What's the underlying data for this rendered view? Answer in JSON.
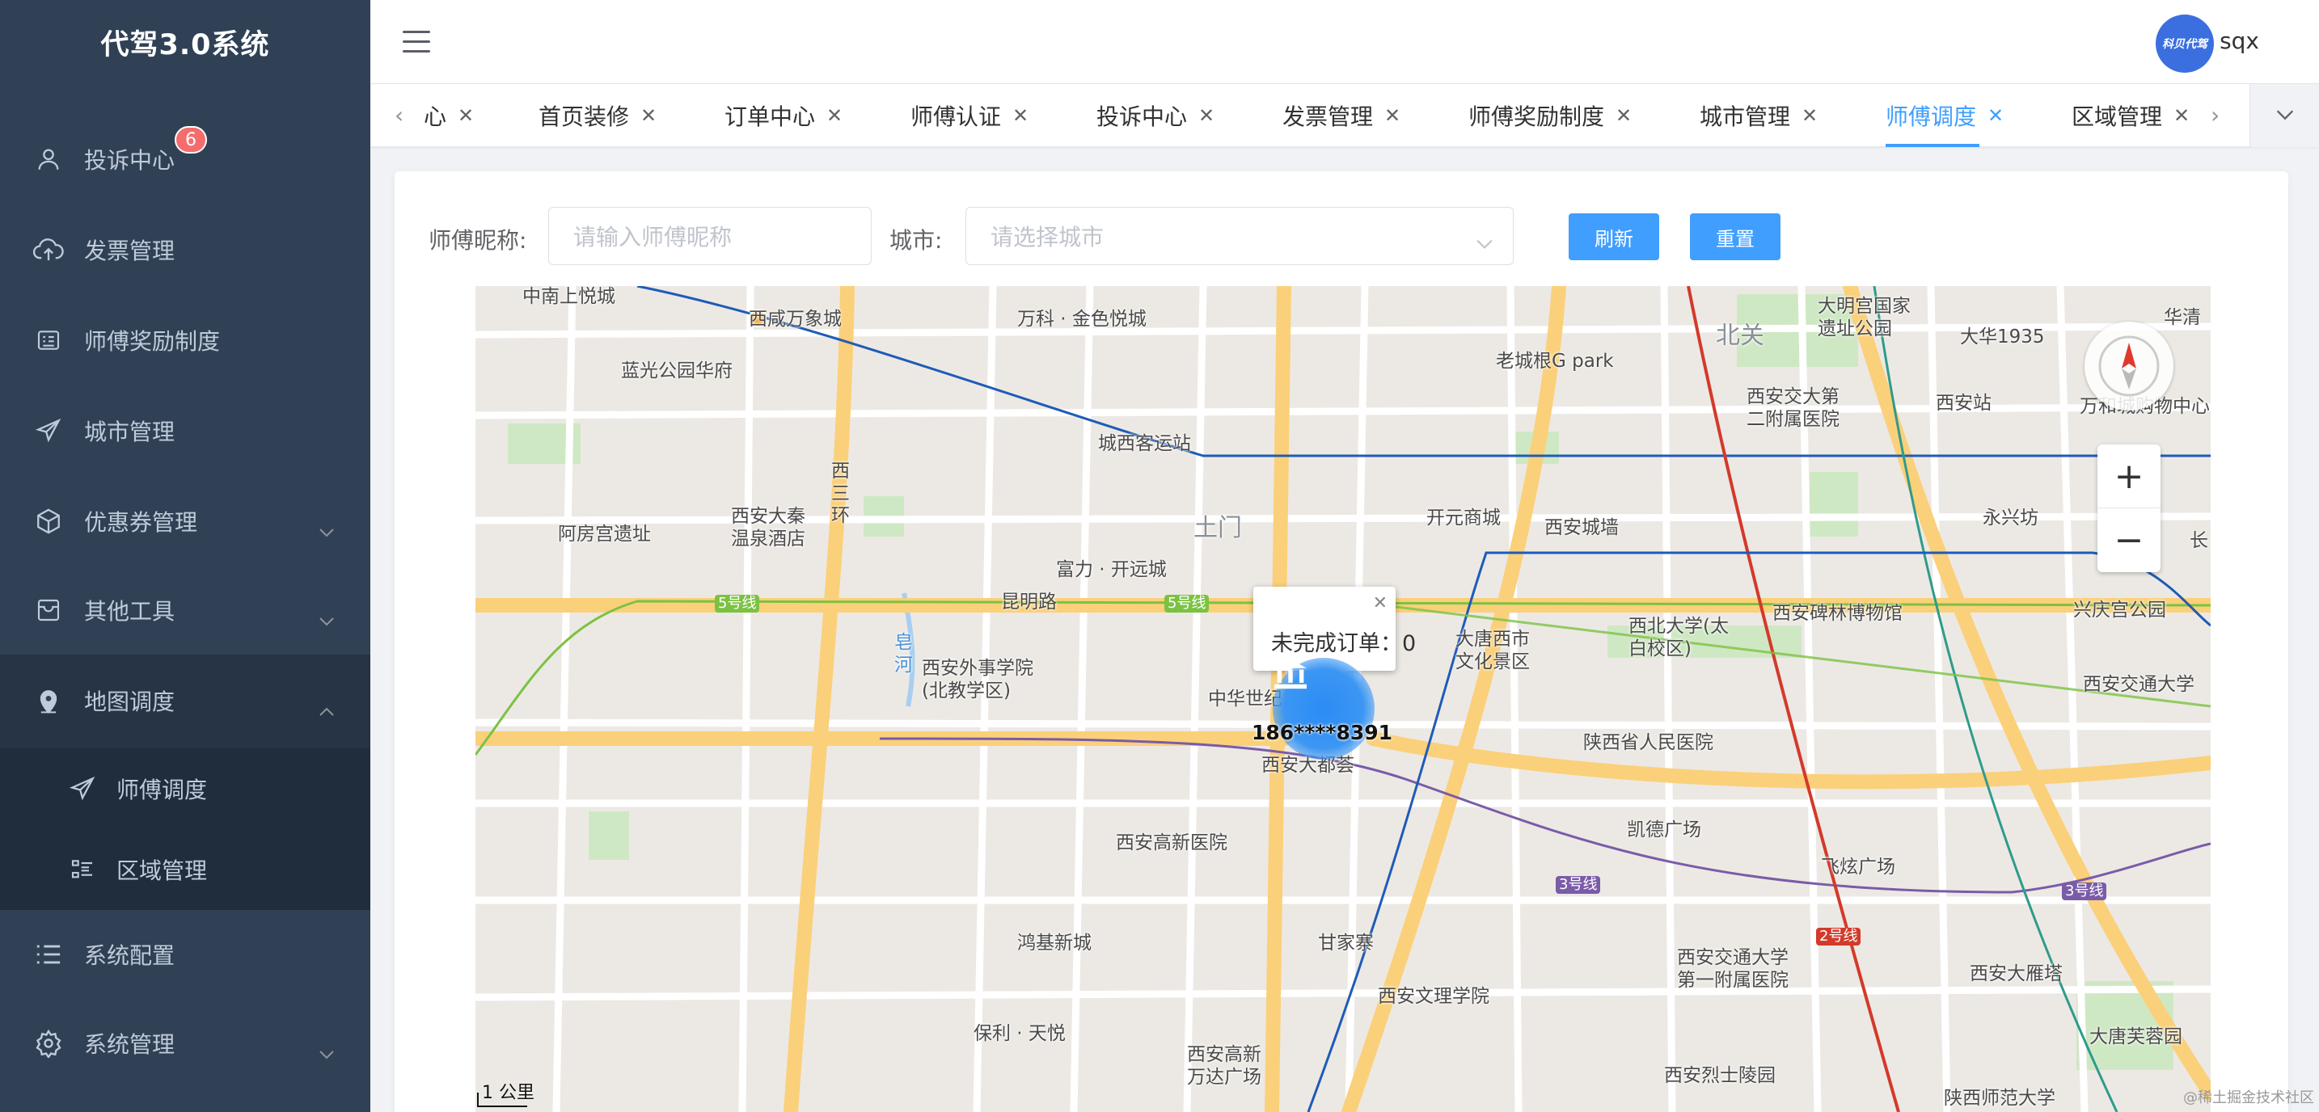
{
  "app": {
    "title": "代驾3.0系统"
  },
  "sidebar": {
    "items": [
      {
        "label": "投诉中心",
        "icon": "user-icon",
        "badge": "6"
      },
      {
        "label": "发票管理",
        "icon": "cloud-upload-icon"
      },
      {
        "label": "师傅奖励制度",
        "icon": "id-card-icon"
      },
      {
        "label": "城市管理",
        "icon": "send-icon"
      },
      {
        "label": "优惠券管理",
        "icon": "box-icon",
        "expandable": true
      },
      {
        "label": "其他工具",
        "icon": "inbox-icon",
        "expandable": true
      },
      {
        "label": "地图调度",
        "icon": "location-icon",
        "expanded": true,
        "children": [
          {
            "label": "师傅调度",
            "icon": "send-icon",
            "active": true
          },
          {
            "label": "区域管理",
            "icon": "list-icon"
          }
        ]
      },
      {
        "label": "系统配置",
        "icon": "list-icon"
      },
      {
        "label": "系统管理",
        "icon": "gear-icon",
        "expandable": true
      }
    ]
  },
  "header": {
    "username": "sqx",
    "avatar_text": "科贝代驾"
  },
  "tabs": [
    {
      "label": "心",
      "active": false
    },
    {
      "label": "首页装修",
      "active": false
    },
    {
      "label": "订单中心",
      "active": false
    },
    {
      "label": "师傅认证",
      "active": false
    },
    {
      "label": "投诉中心",
      "active": false
    },
    {
      "label": "发票管理",
      "active": false
    },
    {
      "label": "师傅奖励制度",
      "active": false
    },
    {
      "label": "城市管理",
      "active": false
    },
    {
      "label": "师傅调度",
      "active": true
    },
    {
      "label": "区域管理",
      "active": false
    }
  ],
  "filters": {
    "nickname_label": "师傅昵称:",
    "nickname_placeholder": "请输入师傅昵称",
    "city_label": "城市:",
    "city_placeholder": "请选择城市",
    "refresh_label": "刷新",
    "reset_label": "重置"
  },
  "map": {
    "info_window_text": "未完成订单：0",
    "marker_label": "186****8391",
    "scale_text": "1 公里",
    "labels": [
      "中南上悦城",
      "西咸万象城",
      "万科 · 金色悦城",
      "老城根G park",
      "北关",
      "大明宫国家遗址公园",
      "大华1935",
      "蓝光公园华府",
      "城西客运站",
      "西安交大第二附属医院",
      "西安站",
      "西安大秦温泉酒店",
      "西三环",
      "阿房宫遗址",
      "土门",
      "开元商城",
      "西安城墙",
      "永兴坊",
      "富力 · 开远城",
      "昆明路",
      "5号线",
      "西北大学(太白校区)",
      "西安碑林博物馆",
      "兴庆宫公园",
      "西安外事学院(北教学区)",
      "皂河",
      "大唐西市文化景区",
      "西安交通大学",
      "中华世纪城",
      "陕西省人民医院",
      "西安大都荟",
      "凯德广场",
      "飞炫广场",
      "西安高新医院",
      "3号线",
      "2号线",
      "鸿基新城",
      "甘家寨",
      "西安交通大学第一附属医院",
      "西安大雁塔",
      "保利 · 天悦",
      "西安文理学院",
      "西安高新万达广场",
      "西安烈士陵园",
      "大唐芙蓉园",
      "陕西师范大学",
      "万和城购物中心",
      "长",
      "华清"
    ],
    "watermark": "@稀土掘金技术社区"
  },
  "colors": {
    "sidebar_bg": "#304156",
    "accent": "#409eff",
    "badge": "#f56c6c"
  }
}
